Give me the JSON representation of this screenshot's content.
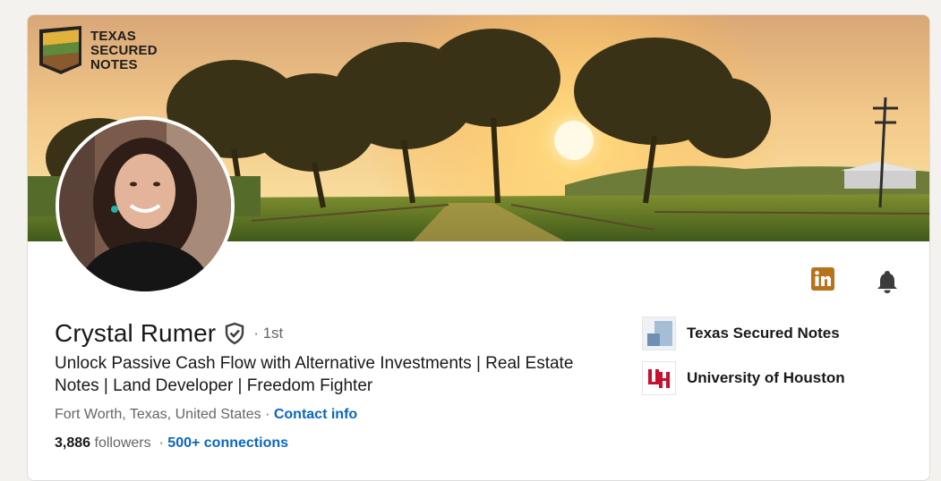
{
  "banner": {
    "brand_lines": [
      "TEXAS",
      "SECURED",
      "NOTES"
    ]
  },
  "profile": {
    "name": "Crystal Rumer",
    "degree": "· 1st",
    "headline": "Unlock Passive Cash Flow with Alternative Investments | Real Estate Notes | Land Developer | Freedom Fighter",
    "location": "Fort Worth, Texas, United States",
    "location_sep": " · ",
    "contact_info_label": "Contact info",
    "followers_count": "3,886",
    "followers_label": " followers",
    "stats_sep": "  · ",
    "connections_label": "500+ connections"
  },
  "organizations": [
    {
      "name": "Texas Secured Notes",
      "logo_icon": "company-placeholder-icon"
    },
    {
      "name": "University of Houston",
      "logo_icon": "uh-logo-icon"
    }
  ],
  "actions": {
    "linkedin_icon": "linkedin-icon",
    "bell_icon": "notification-bell-icon"
  },
  "colors": {
    "link": "#0a66c2",
    "linkedin_badge": "#b8721b",
    "uh_red": "#c8102e"
  }
}
